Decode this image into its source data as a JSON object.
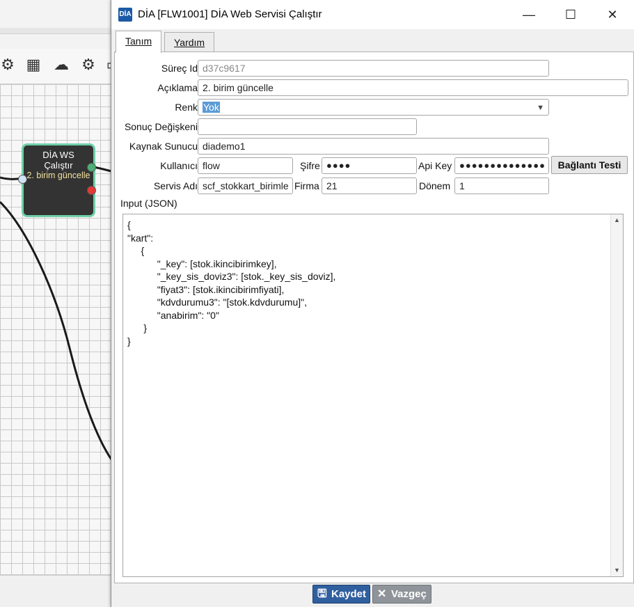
{
  "window": {
    "logo": "DİA",
    "title": "DİA [FLW1001] DİA Web Servisi Çalıştır",
    "minimize": "—",
    "maximize": "☐",
    "close": "✕"
  },
  "tabs": [
    {
      "label": "Tanım",
      "active": true
    },
    {
      "label": "Yardım",
      "active": false
    }
  ],
  "form": {
    "surec_id": {
      "label": "Süreç Id",
      "value": "d37c9617"
    },
    "aciklama": {
      "label": "Açıklama",
      "value": "2. birim güncelle"
    },
    "renk": {
      "label": "Renk",
      "value": "Yok"
    },
    "sonuc_degiskeni": {
      "label": "Sonuç Değişkeni",
      "value": ""
    },
    "kaynak_sunucu": {
      "label": "Kaynak Sunucu",
      "value": "diademo1"
    },
    "kullanici": {
      "label": "Kullanıcı",
      "value": "flow"
    },
    "sifre": {
      "label": "Şifre",
      "value": "●●●●"
    },
    "api_key": {
      "label": "Api Key",
      "value": "●●●●●●●●●●●●●●"
    },
    "baglanti_testi": "Bağlantı Testi",
    "servis_adi": {
      "label": "Servis Adı",
      "value": "scf_stokkart_birimle"
    },
    "firma": {
      "label": "Firma",
      "value": "21"
    },
    "donem": {
      "label": "Dönem",
      "value": "1"
    },
    "input_label": "Input (JSON)",
    "input_json": "{\n\"kart\":\n     {\n           \"_key\": [stok.ikincibirimkey],\n           \"_key_sis_doviz3\": [stok._key_sis_doviz],\n           \"fiyat3\": [stok.ikincibirimfiyati],\n           \"kdvdurumu3\": \"[stok.kdvdurumu]\",\n           \"anabirim\": \"0\"\n      }\n}"
  },
  "buttons": {
    "kaydet": "Kaydet",
    "vazgec": "Vazgeç"
  },
  "canvas_node": {
    "line1": "DİA WS",
    "line2": "Çalıştır",
    "line3": "2. birim güncelle"
  },
  "colors": {
    "node_border": "#6fcfa8",
    "port_green": "#4caf73",
    "port_red": "#e53935",
    "port_blue": "#cfe3f5",
    "save_button": "#2f5f9e",
    "cancel_button": "#8e9499"
  }
}
